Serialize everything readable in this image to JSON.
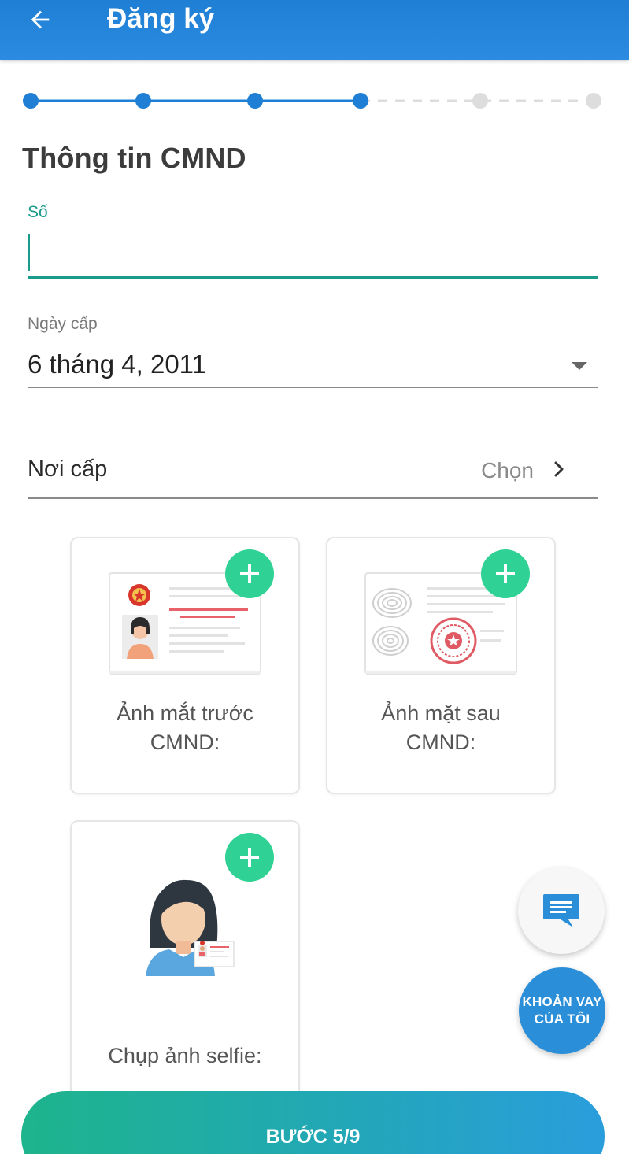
{
  "header": {
    "title": "Đăng ký",
    "back_icon": "arrow-left-icon"
  },
  "stepper": {
    "total_steps": 6,
    "completed_steps": 4,
    "active_color": "#1f7fd4",
    "inactive_color": "#dddddd"
  },
  "section": {
    "title": "Thông tin CMND"
  },
  "so_field": {
    "label": "Số",
    "value": "",
    "placeholder": ""
  },
  "ngay_cap": {
    "label": "Ngày cấp",
    "value": "6 tháng 4, 2011",
    "icon": "dropdown-arrow-icon"
  },
  "noi_cap": {
    "label": "Nơi cấp",
    "action": "Chọn",
    "icon": "chevron-right-icon"
  },
  "cards": {
    "front": {
      "label_line1": "Ảnh mắt trước",
      "label_line2": "CMND:",
      "icon": "id-card-front-icon"
    },
    "back": {
      "label_line1": "Ảnh mặt sau",
      "label_line2": "CMND:",
      "icon": "id-card-back-icon"
    },
    "selfie": {
      "label": "Chụp ảnh selfie:",
      "icon": "selfie-icon"
    },
    "add_icon": "plus-icon"
  },
  "fab": {
    "chat_icon": "chat-bubble-icon",
    "loan_line1": "KHOẢN VAY",
    "loan_line2": "CỦA TÔI"
  },
  "cta": {
    "label": "BƯỚC 5/9"
  },
  "colors": {
    "brand_blue": "#1f7fd4",
    "teal": "#1b9b8c",
    "plus_green": "#2fd294"
  }
}
